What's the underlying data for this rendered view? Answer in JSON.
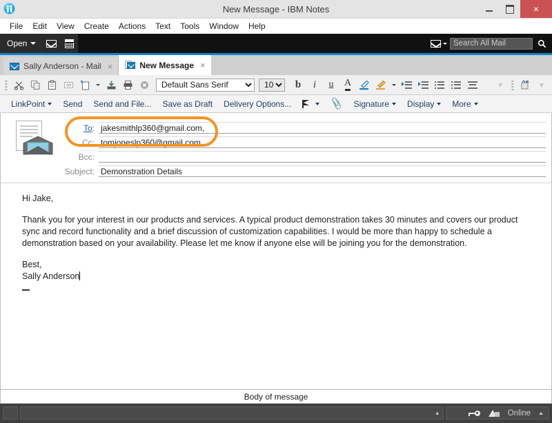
{
  "window": {
    "title": "New Message - IBM Notes",
    "app_icon": "ibm-notes-logo",
    "minimize_label": "–",
    "maximize_label": "□",
    "close_label": "×"
  },
  "menubar": {
    "items": [
      {
        "label": "File"
      },
      {
        "label": "Edit"
      },
      {
        "label": "View"
      },
      {
        "label": "Create"
      },
      {
        "label": "Actions"
      },
      {
        "label": "Text"
      },
      {
        "label": "Tools"
      },
      {
        "label": "Window"
      },
      {
        "label": "Help"
      }
    ]
  },
  "blackbar": {
    "open_label": "Open",
    "mail_icon": "envelope-icon",
    "calendar_icon": "calendar-icon",
    "search": {
      "scope_icon": "envelope-icon",
      "placeholder": "Search All Mail",
      "value": "",
      "submit_icon": "magnifier-icon"
    }
  },
  "tabs": [
    {
      "label": "Sally Anderson - Mail",
      "icon": "envelope-icon",
      "close": "×",
      "active": false
    },
    {
      "label": "New Message",
      "icon": "document-envelope-icon",
      "close": "×",
      "active": true
    }
  ],
  "formatbar": {
    "cut_icon": "scissors-icon",
    "copy_icon": "copy-icon",
    "paste_icon": "clipboard-icon",
    "paste_special_icon": "paste-special-icon",
    "new_icon": "new-document-icon",
    "save_icon": "save-icon",
    "print_icon": "printer-icon",
    "cancel_icon": "cancel-icon",
    "font_family": "Default Sans Serif",
    "font_size": "10",
    "bold_label": "b",
    "italic_label": "i",
    "underline_label": "u",
    "font_color_label": "A",
    "highlight_icon": "marker-icon",
    "text_highlight_icon": "highlighter-icon",
    "indent_icon": "indent-icon",
    "outdent_icon": "outdent-icon",
    "bullet_list_icon": "bullet-list-icon",
    "number_list_icon": "numbered-list-icon",
    "align_icon": "align-center-icon",
    "overflow_icon": "chevron-down-icon",
    "section_icon": "section-icon"
  },
  "actionbar": {
    "items": [
      {
        "label": "LinkPoint",
        "caret": true
      },
      {
        "label": "Send",
        "caret": false
      },
      {
        "label": "Send and File...",
        "caret": false
      },
      {
        "label": "Save as Draft",
        "caret": false
      },
      {
        "label": "Delivery Options...",
        "caret": false
      }
    ],
    "flag_icon": "flag-icon",
    "attach_icon": "paperclip-icon",
    "signature_label": "Signature",
    "display_label": "Display",
    "more_label": "More"
  },
  "compose": {
    "icon": "document-envelope-icon",
    "fields": [
      {
        "label": "To",
        "suffix": ":",
        "value": "jakesmithlp360@gmail.com,",
        "link": true
      },
      {
        "label": "Cc",
        "suffix": ":",
        "value": "tomjoneslp360@gmail.com,",
        "link": false
      },
      {
        "label": "Bcc",
        "suffix": ":",
        "value": "",
        "link": false
      },
      {
        "label": "Subject",
        "suffix": ":",
        "value": "Demonstration Details",
        "link": false
      }
    ],
    "highlight_color": "#f5941f",
    "body": {
      "greeting": "Hi Jake,",
      "paragraph": "Thank you for your interest in our products and services. A typical product demonstration takes 30 minutes and covers our product sync and record functionality and a brief discussion of customization capabilities. I would be more than happy to schedule a demonstration based on your availability. Please let me know if anyone else will be joining you for the demonstration.",
      "closing": "Best,",
      "signature": "Sally Anderson"
    }
  },
  "statusbar": {
    "context_label": "Body of message",
    "key_icon": "key-icon",
    "notes_icon": "notes-icon",
    "online_label": "Online",
    "online_caret": "▴",
    "expand_caret": "▴"
  },
  "colors": {
    "accent_blue": "#1184c9",
    "action_link": "#1f3f66",
    "highlight_orange": "#f5941f",
    "close_red": "#cb5252"
  }
}
